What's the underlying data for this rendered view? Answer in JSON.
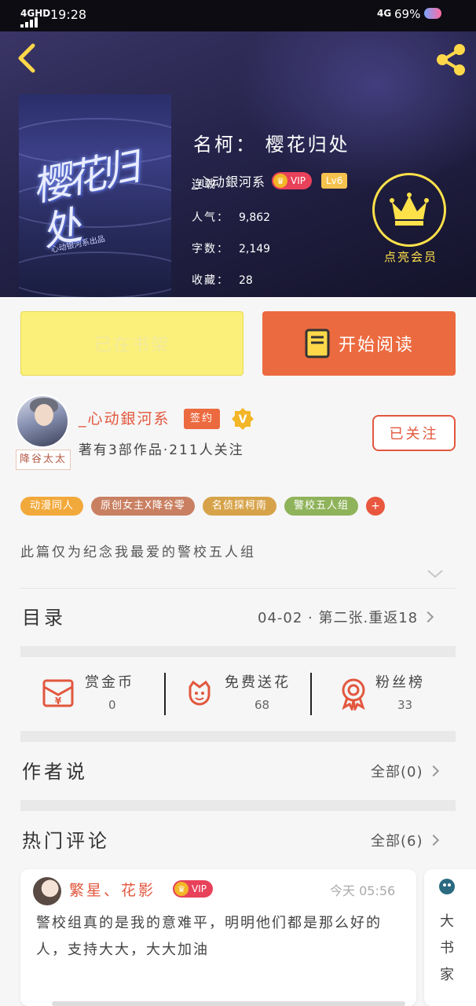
{
  "status_bar": {
    "network_left": "4GHD",
    "time": "19:28",
    "network_right": "4G",
    "battery": "69%"
  },
  "book": {
    "title": "名柯： 樱花归处",
    "cover_title": "樱花归处",
    "cover_subtitle": "心动银河系出品",
    "author": "_心动銀河系",
    "vip_label": "VIP",
    "level": "Lv6",
    "status": "连载",
    "stats": [
      {
        "label": "人气：",
        "value": "9,862"
      },
      {
        "label": "字数：",
        "value": "2,149"
      },
      {
        "label": "收藏：",
        "value": "28"
      }
    ],
    "member_label": "点亮会员"
  },
  "actions": {
    "add_shelf_label": "已在书架",
    "start_read_label": "开始阅读"
  },
  "author_card": {
    "avatar_tag": "降谷太太",
    "name": "_心动銀河系",
    "sign_badge": "签约",
    "summary": "著有3部作品·211人关注",
    "follow_label": "已关注"
  },
  "tags": [
    {
      "label": "动漫同人",
      "color": "#f2a93b"
    },
    {
      "label": "原创女主X降谷零",
      "color": "#c98062"
    },
    {
      "label": "名侦探柯南",
      "color": "#d7a34a"
    },
    {
      "label": "警校五人组",
      "color": "#8fb35a"
    }
  ],
  "tag_more": "+",
  "intro": "此篇仅为纪念我最爱的警校五人组",
  "toc": {
    "title": "目录",
    "latest": "04-02 · 第二张.重返18"
  },
  "rewards": [
    {
      "label": "赏金币",
      "value": "0",
      "icon": "red-envelope-icon"
    },
    {
      "label": "免费送花",
      "value": "68",
      "icon": "flower-icon"
    },
    {
      "label": "粉丝榜",
      "value": "33",
      "icon": "medal-icon"
    }
  ],
  "author_says": {
    "title": "作者说",
    "all_label": "全部(0)"
  },
  "hot_comments": {
    "title": "热门评论",
    "all_label": "全部(6)",
    "items": [
      {
        "user": "繁星、花影",
        "vip": "VIP",
        "time": "今天 05:56",
        "text": "警校组真的是我的意难平，明明他们都是那么好的人，支持大大，大大加油"
      },
      {
        "text": "大书家"
      }
    ]
  },
  "colors": {
    "accent": "#ec6a3f",
    "member_gold": "#ffe14a",
    "shelf_yellow": "#fbf07a"
  }
}
